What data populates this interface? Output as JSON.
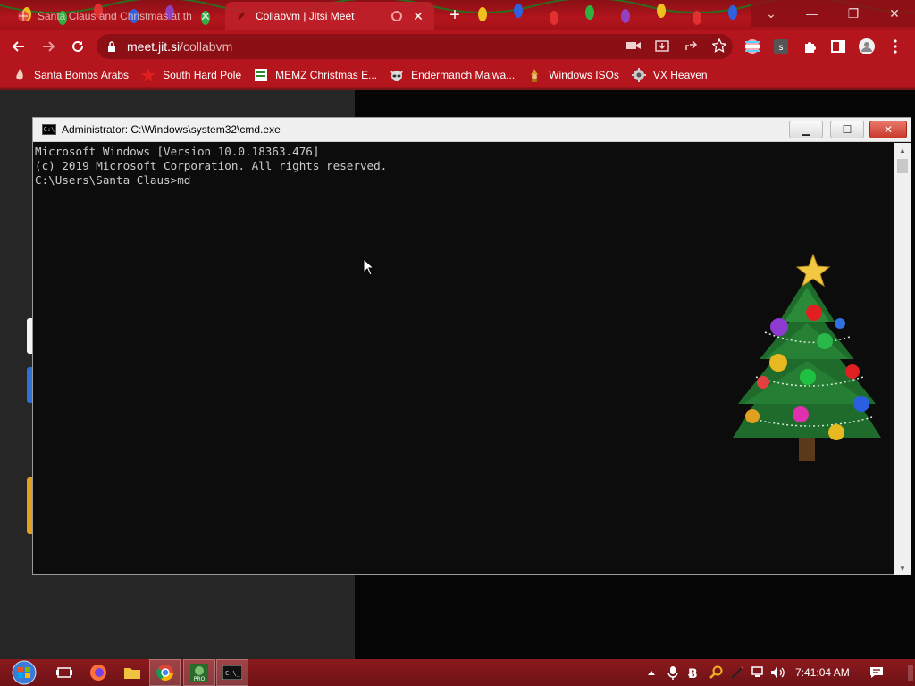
{
  "browser": {
    "tabs": [
      {
        "title": "Santa Claus and Christmas at th",
        "active": false
      },
      {
        "title": "Collabvm | Jitsi Meet",
        "active": true
      }
    ],
    "address": {
      "host": "meet.jit.si",
      "path": "/collabvm"
    },
    "bookmarks": [
      {
        "label": "Santa Bombs Arabs",
        "icon": "flame-icon"
      },
      {
        "label": "South Hard Pole",
        "icon": "red-star-icon"
      },
      {
        "label": "MEMZ Christmas E...",
        "icon": "document-icon"
      },
      {
        "label": "Endermanch Malwa...",
        "icon": "raccoon-icon"
      },
      {
        "label": "Windows ISOs",
        "icon": "gnome-icon"
      },
      {
        "label": "VX Heaven",
        "icon": "gear-icon"
      }
    ],
    "accent": "#b5151d"
  },
  "cmd": {
    "title": "Administrator: C:\\Windows\\system32\\cmd.exe",
    "lines": [
      "Microsoft Windows [Version 10.0.18363.476]",
      "(c) 2019 Microsoft Corporation. All rights reserved.",
      "",
      "C:\\Users\\Santa Claus>md"
    ]
  },
  "taskbar": {
    "clock": "7:41:04 AM",
    "apps": [
      "start-orb-icon",
      "task-view-icon",
      "firefox-icon",
      "folder-icon",
      "chrome-icon",
      "game-pro-icon",
      "cmd-icon"
    ]
  }
}
